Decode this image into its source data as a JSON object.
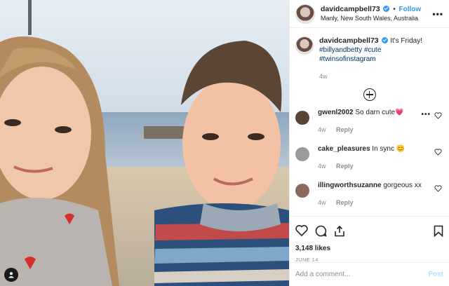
{
  "post": {
    "username": "davidcampbell73",
    "follow_label": "Follow",
    "separator": "•",
    "location": "Manly, New South Wales, Australia",
    "more_label": "•••",
    "caption_text": "It's Friday!",
    "hashtags": [
      "#billyandbetty",
      "#cute",
      "#twinsofinstagram"
    ],
    "caption_time": "4w",
    "likes": "3,148 likes",
    "date": "JUNE 14",
    "comment_placeholder": "Add a comment...",
    "post_label": "Post"
  },
  "comments": [
    {
      "user": "gwenl2002",
      "text": "So darn cute💗",
      "time": "4w",
      "reply": "Reply",
      "avatar_color": "#5b4236"
    },
    {
      "user": "cake_pleasures",
      "text": "In sync 😊",
      "time": "4w",
      "reply": "Reply",
      "avatar_color": "#9a9a9a"
    },
    {
      "user": "illingworthsuzanne",
      "text": "gorgeous xx",
      "time": "4w",
      "reply": "Reply",
      "avatar_color": "#8a6a5a"
    }
  ],
  "colors": {
    "accent": "#3897f0",
    "muted": "#8e8e8e",
    "text": "#262626",
    "post_disabled": "#b2dffc"
  }
}
